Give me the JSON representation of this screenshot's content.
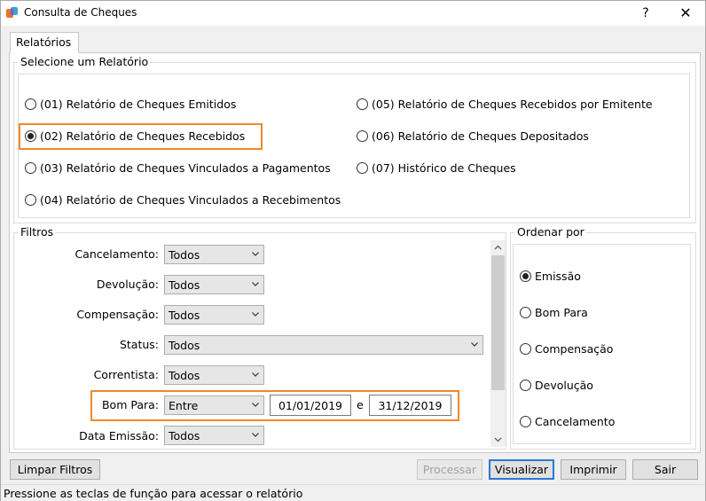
{
  "window": {
    "title": "Consulta de Cheques",
    "help_label": "?",
    "close_label": "✕"
  },
  "tab": {
    "label": "Relatórios"
  },
  "reports": {
    "group_title": "Selecione um Relatório",
    "items": [
      {
        "label": "(01) Relatório de Cheques Emitidos",
        "checked": false
      },
      {
        "label": "(02) Relatório de Cheques Recebidos",
        "checked": true
      },
      {
        "label": "(03) Relatório de Cheques Vinculados a Pagamentos",
        "checked": false
      },
      {
        "label": "(04) Relatório de Cheques Vinculados a Recebimentos",
        "checked": false
      },
      {
        "label": "(05) Relatório de Cheques Recebidos por Emitente",
        "checked": false
      },
      {
        "label": "(06) Relatório de Cheques Depositados",
        "checked": false
      },
      {
        "label": "(07) Histórico de Cheques",
        "checked": false
      }
    ]
  },
  "filters": {
    "group_title": "Filtros",
    "cancelamento": {
      "label": "Cancelamento:",
      "value": "Todos"
    },
    "devolucao": {
      "label": "Devolução:",
      "value": "Todos"
    },
    "compensacao": {
      "label": "Compensação:",
      "value": "Todos"
    },
    "status": {
      "label": "Status:",
      "value": "Todos"
    },
    "correntista": {
      "label": "Correntista:",
      "value": "Todos"
    },
    "bom_para": {
      "label": "Bom Para:",
      "value": "Entre",
      "from": "01/01/2019",
      "sep": "e",
      "to": "31/12/2019"
    },
    "data_emissao": {
      "label": "Data Emissão:",
      "value": "Todos"
    }
  },
  "order": {
    "group_title": "Ordenar por",
    "items": [
      {
        "label": "Emissão",
        "checked": true
      },
      {
        "label": "Bom Para",
        "checked": false
      },
      {
        "label": "Compensação",
        "checked": false
      },
      {
        "label": "Devolução",
        "checked": false
      },
      {
        "label": "Cancelamento",
        "checked": false
      }
    ]
  },
  "buttons": {
    "limpar": "Limpar Filtros",
    "processar": "Processar",
    "visualizar": "Visualizar",
    "imprimir": "Imprimir",
    "sair": "Sair"
  },
  "status_bar": "Pressione as teclas de função para acessar o relatório",
  "colors": {
    "highlight": "#f0892b",
    "default_button_border": "#2b78d4"
  }
}
